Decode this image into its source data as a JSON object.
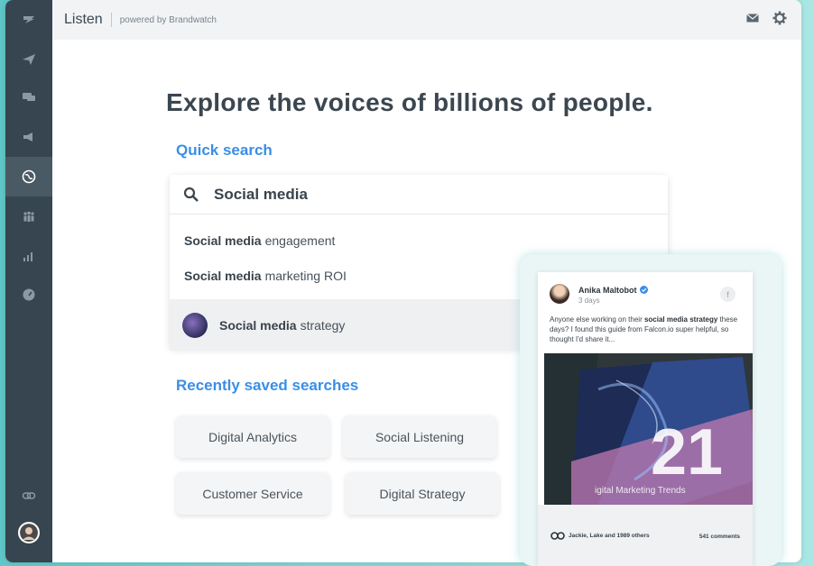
{
  "app": {
    "title": "Listen",
    "subtitle": "powered by Brandwatch"
  },
  "sidebar": {
    "items": [
      {
        "icon": "logo-icon"
      },
      {
        "icon": "paper-plane-icon"
      },
      {
        "icon": "chat-bubbles-icon"
      },
      {
        "icon": "megaphone-icon"
      },
      {
        "icon": "globe-icon",
        "active": true
      },
      {
        "icon": "people-icon"
      },
      {
        "icon": "bar-chart-icon"
      },
      {
        "icon": "speedometer-icon"
      }
    ],
    "bottom": [
      {
        "icon": "link-icon"
      },
      {
        "icon": "user-avatar"
      }
    ]
  },
  "topbar": {
    "actions": [
      {
        "icon": "mail-icon"
      },
      {
        "icon": "gear-icon"
      }
    ]
  },
  "main": {
    "headline": "Explore the voices of billions of people.",
    "quick_search_label": "Quick search",
    "search_value": "Social media",
    "suggestions": [
      {
        "bold": "Social media",
        "rest": "engagement"
      },
      {
        "bold": "Social media",
        "rest": "marketing ROI"
      },
      {
        "bold": "Social media",
        "rest": "strategy"
      }
    ],
    "saved_label": "Recently saved searches",
    "saved_searches": [
      "Digital Analytics",
      "Social Listening",
      "Customer Service",
      "Digital Strategy"
    ]
  },
  "post": {
    "author": "Anika Maltobot",
    "time": "3 days",
    "text_before": "Anyone else working on their ",
    "text_bold": "social media strategy",
    "text_after": " these days? I found this guide from Falcon.io super helpful, so thought I'd share it...",
    "image_big_number": "21",
    "image_caption": "igital Marketing Trends",
    "likes": "Jackie, Lake and 1989 others",
    "comments": "541 comments",
    "fb_glyph": "f"
  },
  "colors": {
    "sidebar": "#36454f",
    "accent_blue": "#3a8ee6",
    "frame_teal": "#5fc7c9"
  }
}
